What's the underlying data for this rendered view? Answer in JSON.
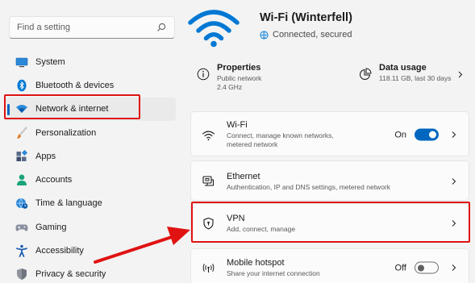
{
  "search": {
    "placeholder": "Find a setting",
    "icon": "search-icon"
  },
  "sidebar": {
    "items": [
      {
        "label": "System",
        "icon": "system-icon",
        "selected": false
      },
      {
        "label": "Bluetooth & devices",
        "icon": "bluetooth-icon",
        "selected": false
      },
      {
        "label": "Network & internet",
        "icon": "network-icon",
        "selected": true
      },
      {
        "label": "Personalization",
        "icon": "brush-icon",
        "selected": false
      },
      {
        "label": "Apps",
        "icon": "apps-icon",
        "selected": false
      },
      {
        "label": "Accounts",
        "icon": "person-icon",
        "selected": false
      },
      {
        "label": "Time & language",
        "icon": "globe-clock-icon",
        "selected": false
      },
      {
        "label": "Gaming",
        "icon": "gamepad-icon",
        "selected": false
      },
      {
        "label": "Accessibility",
        "icon": "accessibility-icon",
        "selected": false
      },
      {
        "label": "Privacy & security",
        "icon": "shield-icon",
        "selected": false
      }
    ]
  },
  "header": {
    "title": "Wi-Fi (Winterfell)",
    "status": "Connected, secured"
  },
  "properties": {
    "title": "Properties",
    "line1": "Public network",
    "line2": "2.4 GHz"
  },
  "data_usage": {
    "title": "Data usage",
    "detail": "118.11 GB, last 30 days"
  },
  "rows": {
    "wifi": {
      "title": "Wi-Fi",
      "sub1": "Connect, manage known networks,",
      "sub2": "metered network",
      "toggle_label": "On",
      "toggle_on": true
    },
    "ethernet": {
      "title": "Ethernet",
      "sub": "Authentication, IP and DNS settings, metered network"
    },
    "vpn": {
      "title": "VPN",
      "sub": "Add, connect, manage"
    },
    "hotspot": {
      "title": "Mobile hotspot",
      "sub": "Share your internet connection",
      "toggle_label": "Off",
      "toggle_on": false
    }
  },
  "colors": {
    "accent": "#0067c0",
    "annotation": "#e01212",
    "background": "#f3f3f3",
    "card": "#fbfbfb"
  }
}
